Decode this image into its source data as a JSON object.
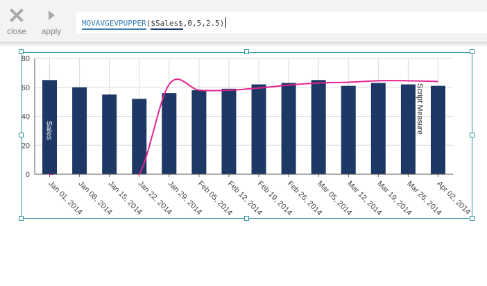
{
  "toolbar": {
    "close_label": "close",
    "apply_label": "apply",
    "close_icon": "x-icon",
    "apply_icon": "play-icon"
  },
  "formula": {
    "function_name": "MOVAVGEVPUPPER",
    "open_paren": "(",
    "argument": "$Sales$",
    "rest": ",0,5,2.5)"
  },
  "colors": {
    "bar": "#1d3864",
    "line": "#e2248f",
    "grid": "#d9d9d9",
    "frame": "#2a8d9a"
  },
  "chart_data": {
    "type": "bar",
    "categories": [
      "Jan 01, 2014",
      "Jan 08, 2014",
      "Jan 15, 2014",
      "Jan 22, 2014",
      "Jan 29, 2014",
      "Feb 05, 2014",
      "Feb 12, 2014",
      "Feb 19, 2014",
      "Feb 26, 2014",
      "Mar 05, 2014",
      "Mar 12, 2014",
      "Mar 19, 2014",
      "Mar 26, 2014",
      "Apr 02, 2014"
    ],
    "series": [
      {
        "name": "Sales",
        "type": "bar",
        "values": [
          65,
          60,
          55,
          52,
          56,
          58,
          59,
          62,
          63,
          65,
          61,
          63,
          62,
          61
        ]
      },
      {
        "name": "Script Measure",
        "type": "line",
        "values": [
          0,
          -6,
          -8,
          0,
          62,
          58,
          58,
          59.5,
          61.5,
          63,
          63.5,
          64.5,
          64.5,
          64
        ]
      }
    ],
    "ylim": [
      0,
      80
    ],
    "yticks": [
      0,
      20,
      40,
      60,
      80
    ],
    "grid": true,
    "legend": "none"
  }
}
